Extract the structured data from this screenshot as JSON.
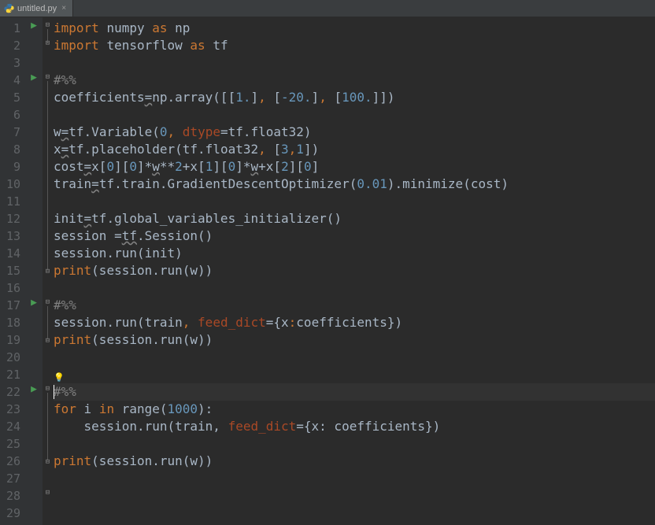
{
  "tab": {
    "label": "untitled.py"
  },
  "lines": {
    "count": 29,
    "run_markers_at": [
      1,
      4,
      17,
      22
    ],
    "active_line": 22
  },
  "code": {
    "l1": {
      "kw1": "import",
      "sp": " ",
      "id1": "numpy",
      "sp2": " ",
      "kw2": "as",
      "sp3": " ",
      "id2": "np"
    },
    "l2": {
      "kw1": "import",
      "sp": " ",
      "id1": "tensorflow",
      "sp2": " ",
      "kw2": "as",
      "sp3": " ",
      "id2": "tf"
    },
    "l4": {
      "cell": "#%%"
    },
    "l5": {
      "a": "coefficients",
      "eq": "=",
      "b": "np.array([[",
      "n1": "1.",
      "c1": "]",
      "cm1": ",",
      "sp1": "[",
      "n2": "-20.",
      "c2": "]",
      "cm2": ",",
      "sp2": "[",
      "n3": "100.",
      "c3": "]])"
    },
    "l7": {
      "a": "w",
      "eq": "=",
      "b": "tf.Variable(",
      "n1": "0",
      "cm": ",",
      "kw": "dtype",
      "eq2": "=",
      "c": "tf.float32)"
    },
    "l8": {
      "a": "x",
      "eq": "=",
      "b": "tf.placeholder(tf.float32",
      "cm": ",",
      "c": "[",
      "n1": "3",
      "cm2": ",",
      "n2": "1",
      "d": "])"
    },
    "l9": {
      "a": "cost",
      "eq": "=",
      "b": "x[",
      "n0": "0",
      "b2": "][",
      "n0b": "0",
      "b3": "]*",
      "w": "w",
      "b4": "**",
      "n2": "2",
      "b5": "+x[",
      "n1": "1",
      "b6": "][",
      "n0c": "0",
      "b7": "]*",
      "w2": "w",
      "b8": "+x[",
      "n2b": "2",
      "b9": "][",
      "n0d": "0",
      "b10": "]"
    },
    "l10": {
      "a": "train",
      "eq": "=",
      "b": "tf.train.GradientDescentOptimizer(",
      "n": "0.01",
      "c": ").minimize(cost)"
    },
    "l12": {
      "a": "init",
      "eq": "=",
      "b": "tf.global_variables_initializer()"
    },
    "l13": {
      "a": "session ",
      "eq": "=",
      "b": "tf",
      "c": ".Session()"
    },
    "l14": {
      "a": "session.run(init)"
    },
    "l15": {
      "a": "print",
      "b": "(session.run(w))"
    },
    "l17": {
      "cell": "#%%"
    },
    "l18": {
      "a": "session.run(train",
      "cm": ",",
      "sp": " ",
      "kw": "feed_dict",
      "eq": "=",
      "b": "{x",
      "cl": ":",
      "c": "coefficients})"
    },
    "l19": {
      "a": "print",
      "b": "(session.run(w))"
    },
    "l22": {
      "cell": "#%%"
    },
    "l23": {
      "kw": "for",
      "sp": " ",
      "a": "i ",
      "kw2": "in",
      "sp2": " ",
      "fn": "range",
      "b": "(",
      "n": "1000",
      "c": "):"
    },
    "l24": {
      "indent": "    ",
      "a": "session.run(train, ",
      "kw": "feed_dict",
      "eq": "=",
      "b": "{x: coefficients})"
    },
    "l26": {
      "a": "print",
      "b": "(session.run(w))"
    }
  }
}
